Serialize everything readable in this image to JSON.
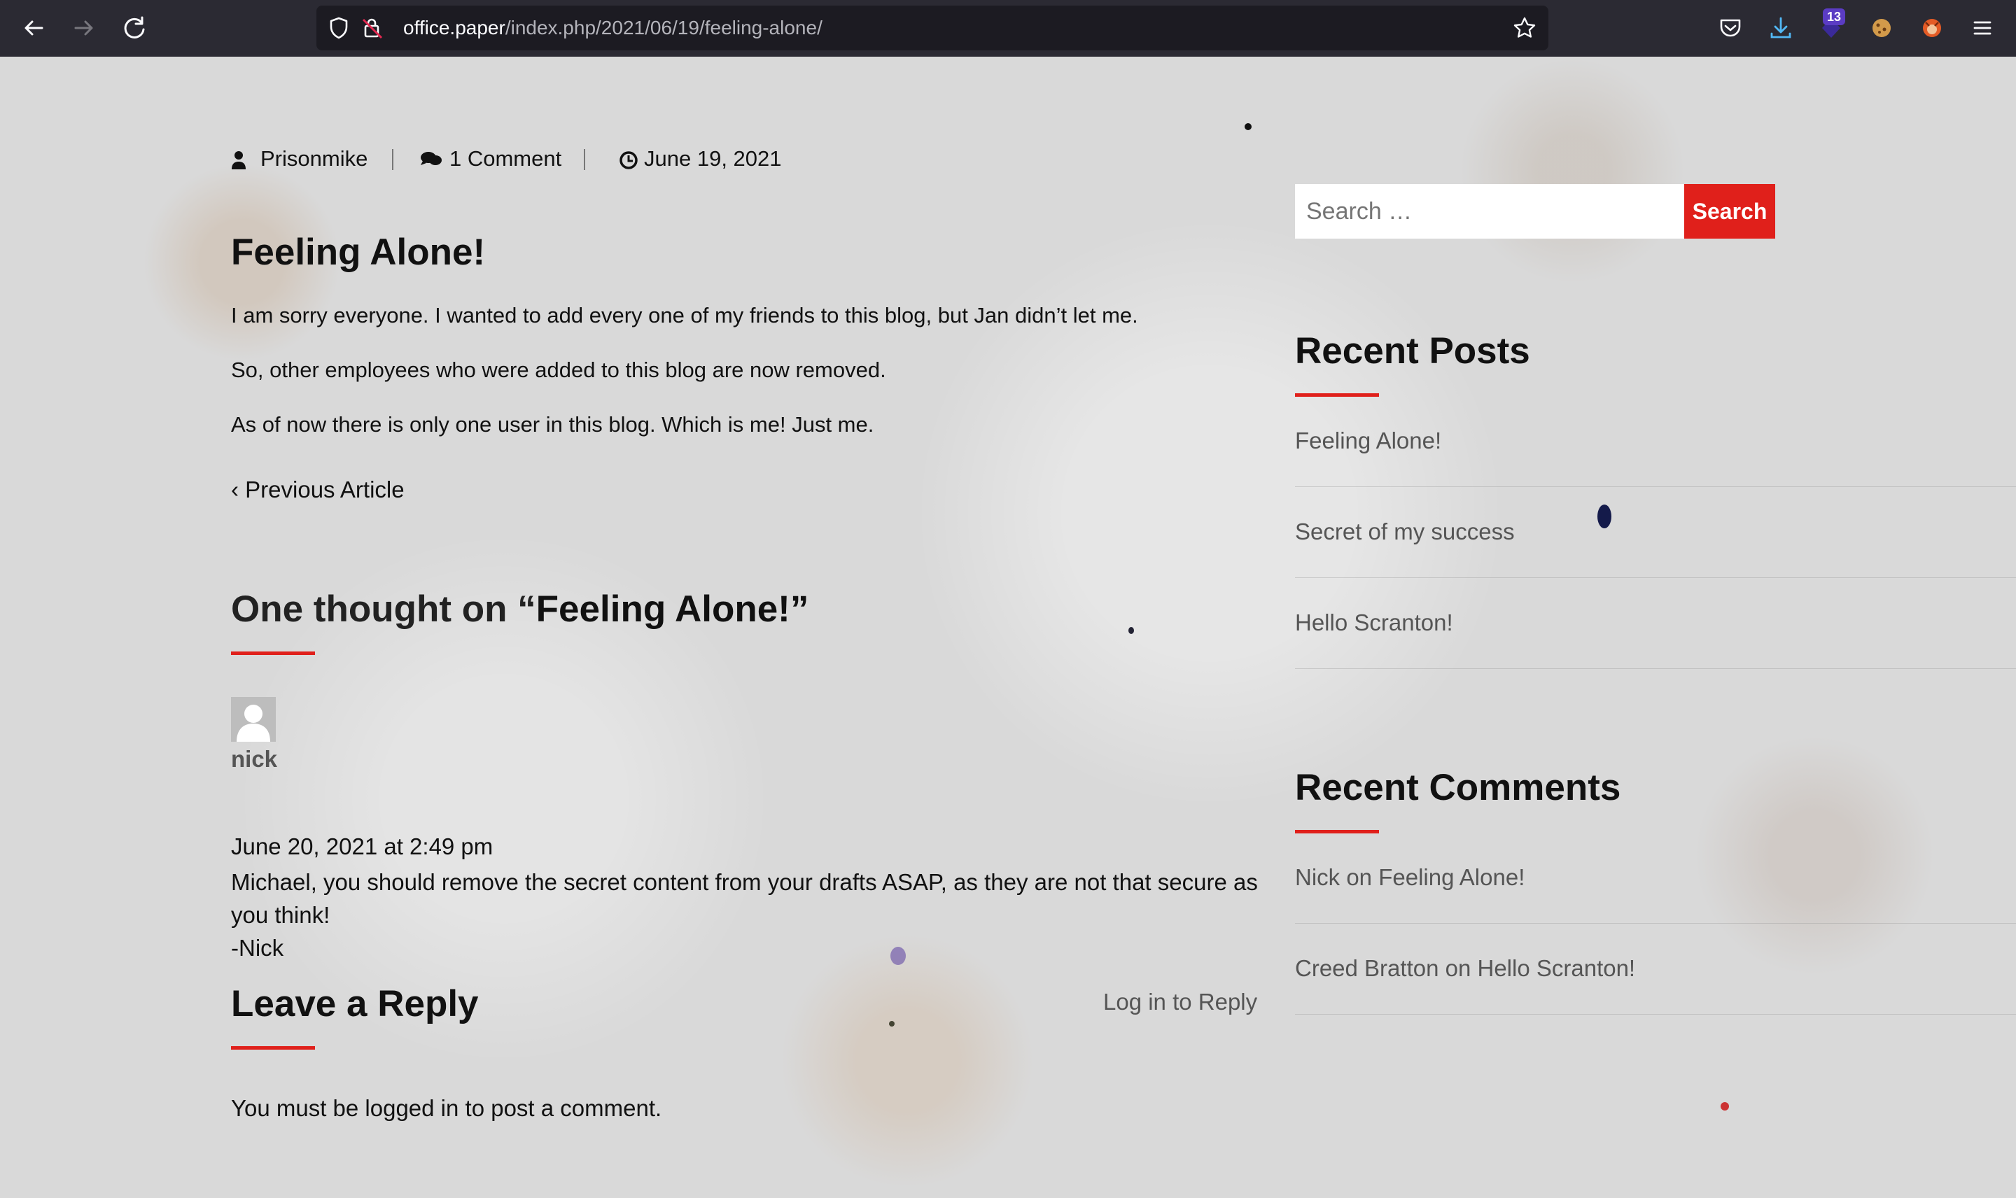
{
  "browser": {
    "url_host": "office.paper",
    "url_path": "/index.php/2021/06/19/feeling-alone/",
    "extension_badge": "13"
  },
  "post": {
    "author": "Prisonmike",
    "comments_count": "1 Comment",
    "date": "June 19, 2021",
    "title": "Feeling Alone!",
    "paragraphs": [
      "I am sorry everyone. I wanted to add every one of my friends to this blog, but Jan didn’t let me.",
      "So, other employees who were added to this blog are now removed.",
      "As of now there is only one user in this blog. Which is me! Just me."
    ],
    "previous_article": "‹ Previous Article"
  },
  "comments": {
    "heading_prefix": "One thought on “",
    "heading_post": "Feeling Alone!",
    "heading_suffix": "”",
    "items": [
      {
        "author": "nick",
        "date": "June 20, 2021 at 2:49 pm",
        "lines": [
          "Michael, you should remove the secret content from your drafts ASAP, as they are not that secure as",
          "you think!",
          "-Nick"
        ]
      }
    ]
  },
  "reply": {
    "title": "Leave a Reply",
    "login_link": "Log in to Reply",
    "must_login": "You must be logged in to post a comment."
  },
  "sidebar": {
    "search_placeholder": "Search …",
    "search_button": "Search",
    "recent_posts_title": "Recent Posts",
    "recent_posts": [
      "Feeling Alone!",
      "Secret of my success",
      "Hello Scranton!"
    ],
    "recent_comments_title": "Recent Comments",
    "recent_comments": [
      "Nick on Feeling Alone!",
      "Creed Bratton on Hello Scranton!"
    ]
  },
  "colors": {
    "accent": "#e0201b",
    "chrome_bg": "#2b2a33",
    "urlbar_bg": "#1c1b22"
  }
}
